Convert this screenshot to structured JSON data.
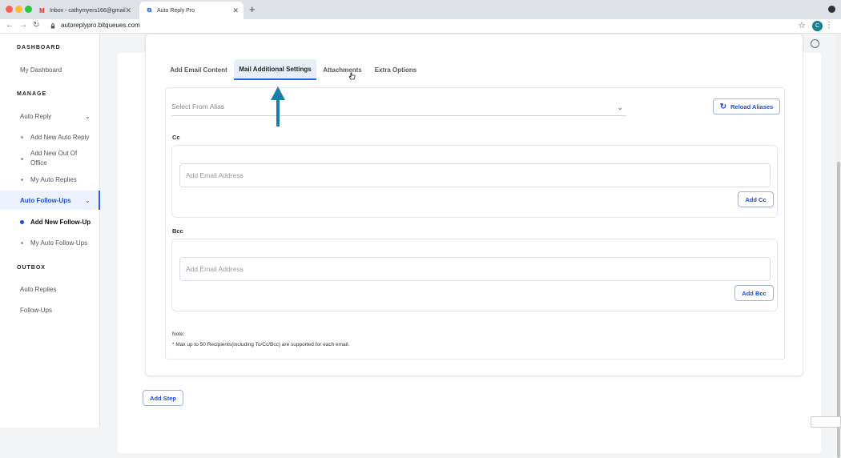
{
  "browser": {
    "tabs": [
      {
        "label": "Inbox - cathymyers166@gmail"
      },
      {
        "label": "Auto Reply Pro"
      }
    ],
    "url": "autoreplypro.bitqueues.com",
    "profile_initial": "C"
  },
  "sidebar": {
    "sections": {
      "dashboard": "DASHBOARD",
      "manage": "MANAGE",
      "outbox": "OUTBOX"
    },
    "items": {
      "my_dashboard": "My Dashboard",
      "auto_reply": "Auto Reply",
      "add_new_auto_reply": "Add New Auto Reply",
      "add_new_out_of_office": "Add New Out Of Office",
      "my_auto_replies": "My Auto Replies",
      "auto_follow_ups": "Auto Follow-Ups",
      "add_new_follow_up": "Add New Follow-Up",
      "my_auto_follow_ups": "My Auto Follow-Ups",
      "auto_replies": "Auto Replies",
      "follow_ups": "Follow-Ups"
    }
  },
  "content_tabs": [
    "Add Email Content",
    "Mail Additional Settings",
    "Attachments",
    "Extra Options"
  ],
  "alias": {
    "placeholder": "Select From Alias",
    "reload_label": "Reload Aliases"
  },
  "cc": {
    "label": "Cc",
    "placeholder": "Add Email Address",
    "button": "Add Cc"
  },
  "bcc": {
    "label": "Bcc",
    "placeholder": "Add Email Address",
    "button": "Add Bcc"
  },
  "note": {
    "title": "Note:",
    "text": "* Max up to 50 Recipients(including To/Cc/Bcc) are supported for each email."
  },
  "add_step": "Add Step",
  "colors": {
    "accent": "#2563eb",
    "arrow": "#1a7fa8"
  }
}
